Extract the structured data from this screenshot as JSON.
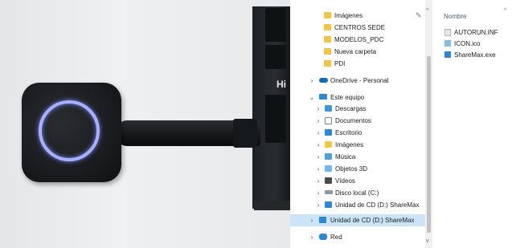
{
  "nav_pane": {
    "items": [
      {
        "label": "Imágenes",
        "icon": "images-folder-icon",
        "pinned": true
      },
      {
        "label": "CENTROS SEDE",
        "icon": "folder-icon"
      },
      {
        "label": "MODELOS_PDC",
        "icon": "folder-icon"
      },
      {
        "label": "Nueva carpeta",
        "icon": "folder-icon"
      },
      {
        "label": "PDI",
        "icon": "folder-icon"
      },
      {
        "label": "OneDrive - Personal",
        "icon": "onedrive-cloud-icon"
      },
      {
        "label": "Este equipo",
        "icon": "this-pc-icon",
        "expanded": true
      },
      {
        "label": "Descargas",
        "icon": "downloads-folder-icon"
      },
      {
        "label": "Documentos",
        "icon": "documents-folder-icon"
      },
      {
        "label": "Escritorio",
        "icon": "desktop-folder-icon"
      },
      {
        "label": "Imágenes",
        "icon": "images-folder-icon"
      },
      {
        "label": "Música",
        "icon": "music-folder-icon"
      },
      {
        "label": "Objetos 3D",
        "icon": "3d-objects-folder-icon"
      },
      {
        "label": "Vídeos",
        "icon": "videos-folder-icon"
      },
      {
        "label": "Disco local (C:)",
        "icon": "local-disk-icon"
      },
      {
        "label": "Unidad de CD (D:) ShareMax",
        "icon": "cd-drive-icon"
      },
      {
        "label": "Unidad de CD (D:) ShareMax",
        "icon": "cd-drive-icon",
        "selected": true
      },
      {
        "label": "Red",
        "icon": "network-icon"
      }
    ]
  },
  "file_list": {
    "column_header": "Nombre",
    "files": [
      {
        "name": "AUTORUN.INF",
        "icon": "inf-file-icon"
      },
      {
        "name": "ICON.ico",
        "icon": "ico-file-icon"
      },
      {
        "name": "ShareMax.exe",
        "icon": "exe-file-icon"
      }
    ]
  },
  "photo": {
    "laptop_badge": "Hi"
  },
  "colors": {
    "selection": "#cce4f7",
    "folder_yellow": "#f4c542",
    "accent_blue": "#2b88d8",
    "ring_glow": "#a7b2ff"
  }
}
